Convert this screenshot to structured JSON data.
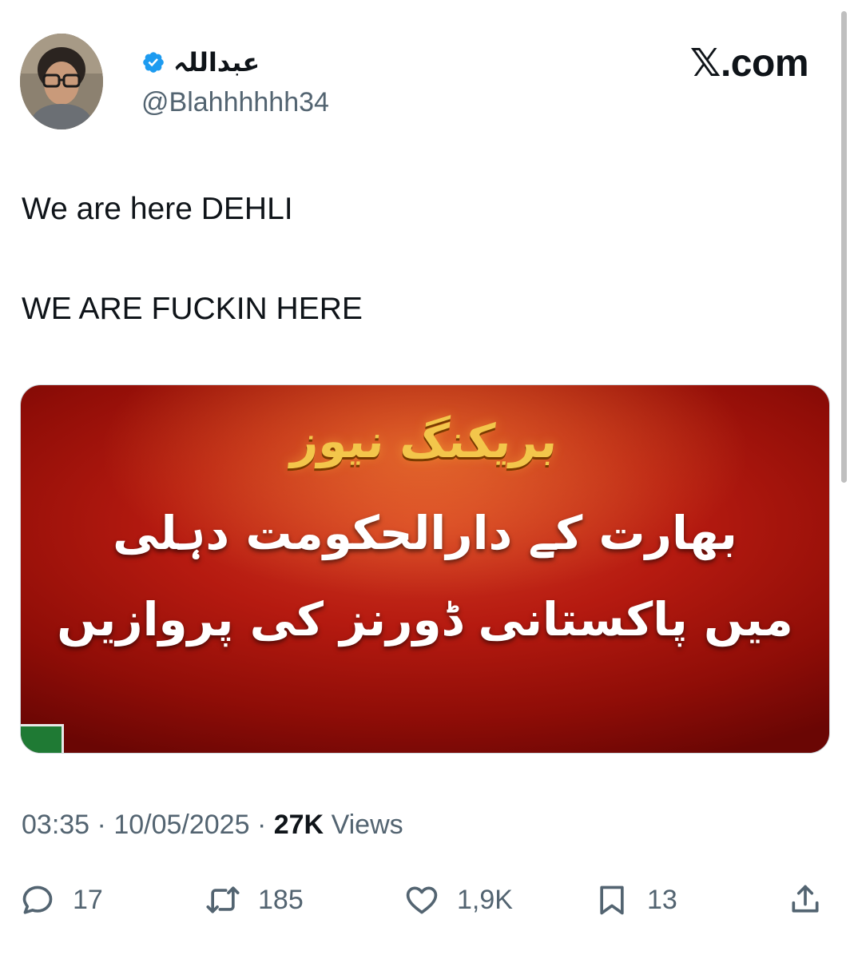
{
  "author": {
    "display_name": "عبداللہ",
    "handle": "@Blahhhhhh34",
    "verified": true
  },
  "brand": "𝕏.com",
  "tweet": {
    "line1": "We are here DEHLI",
    "line2": "WE ARE FUCKIN HERE"
  },
  "media": {
    "header": "بریکنگ نیوز",
    "line1": "بھارت کے دارالحکومت دہلی",
    "line2": "میں پاکستانی ڈورنز کی پروازیں"
  },
  "meta": {
    "time": "03:35",
    "date": "10/05/2025",
    "views_count": "27K",
    "views_label": "Views",
    "separator": "·"
  },
  "actions": {
    "replies": "17",
    "reposts": "185",
    "likes": "1,9K",
    "bookmarks": "13"
  },
  "colors": {
    "text_primary": "#0f1419",
    "text_secondary": "#536471",
    "verified_blue": "#1d9bf0",
    "media_red": "#b51a10",
    "headline_gold": "#f3c64b"
  }
}
